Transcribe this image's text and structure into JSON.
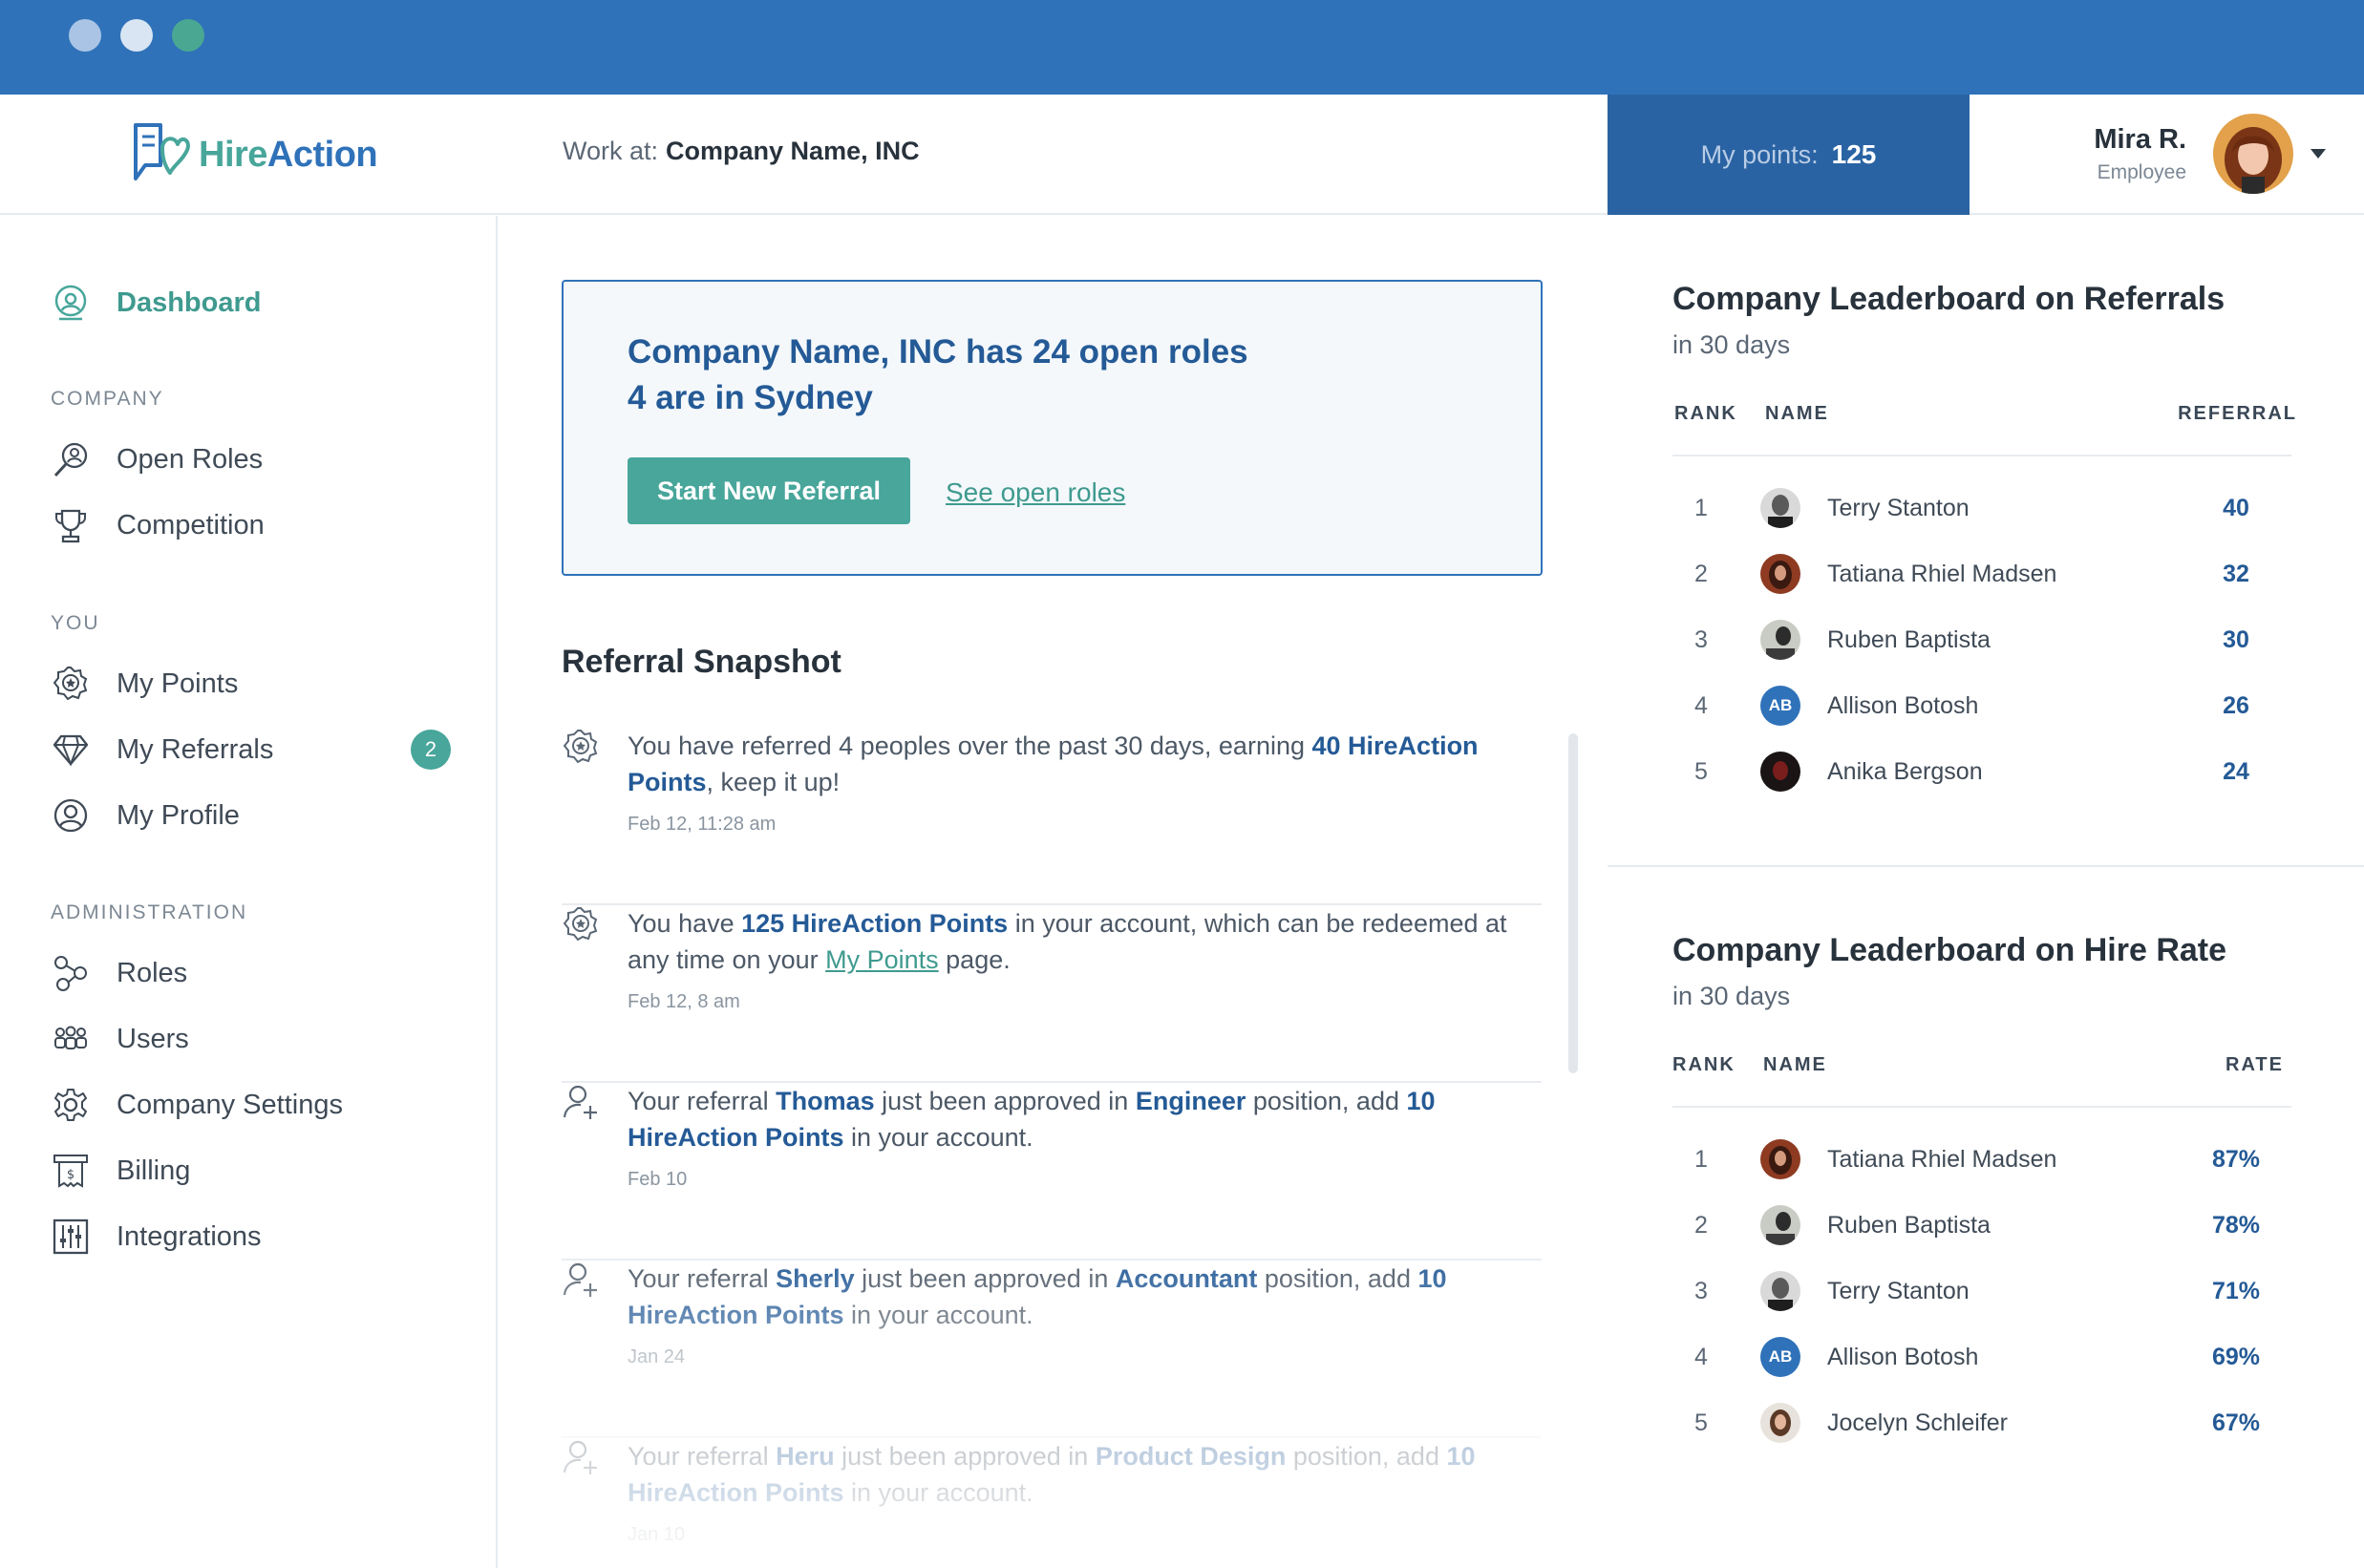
{
  "colors": {
    "chrome": "#2f72b9",
    "brand_teal": "#48a69b",
    "brand_blue": "#245a96",
    "points_bg": "#2a63a3"
  },
  "header": {
    "logo_hire": "Hire",
    "logo_action": "Action",
    "work_at_label": "Work at:",
    "company": "Company Name, INC",
    "points_label": "My points:",
    "points_value": "125",
    "user_name": "Mira R.",
    "user_role": "Employee"
  },
  "sidebar": {
    "dashboard": "Dashboard",
    "section_company": "COMPANY",
    "open_roles": "Open Roles",
    "competition": "Competition",
    "section_you": "YOU",
    "my_points": "My Points",
    "my_referrals": "My Referrals",
    "my_referrals_badge": "2",
    "my_profile": "My Profile",
    "section_admin": "ADMINISTRATION",
    "roles": "Roles",
    "users": "Users",
    "company_settings": "Company Settings",
    "billing": "Billing",
    "integrations": "Integrations"
  },
  "banner": {
    "line1": "Company Name, INC has 24 open roles",
    "line2": "4 are in Sydney",
    "cta": "Start New Referral",
    "link": "See open roles"
  },
  "snapshot": {
    "title": "Referral Snapshot",
    "items": [
      {
        "icon": "badge-icon",
        "t1": "You have referred 4 peoples over the past 30 days, earning ",
        "b1": "40 HireAction Points",
        "t2": ", keep it up!",
        "date": "Feb 12, 11:28 am"
      },
      {
        "icon": "badge-icon",
        "t1": "You have ",
        "b1": "125 HireAction Points",
        "t2": " in your account, which can be redeemed at any time on your ",
        "link": "My Points",
        "t3": " page.",
        "date": "Feb 12, 8 am"
      },
      {
        "icon": "user-plus-icon",
        "t1": "Your referral ",
        "b1": "Thomas",
        "t2": " just been approved in ",
        "b2": "Engineer",
        "t3": " position, add ",
        "b3": "10 HireAction Points",
        "t4": " in your account.",
        "date": "Feb 10"
      },
      {
        "icon": "user-plus-icon",
        "t1": "Your referral ",
        "b1": "Sherly",
        "t2": " just been approved in ",
        "b2": "Accountant",
        "t3": " position, add ",
        "b3": "10 HireAction Points",
        "t4": " in your account.",
        "date": "Jan 24"
      },
      {
        "icon": "user-plus-icon",
        "t1": "Your referral ",
        "b1": "Heru",
        "t2": " just been approved in ",
        "b2": "Product Design",
        "t3": " position, add ",
        "b3": "10 HireAction Points",
        "t4": " in your account.",
        "date": "Jan 10"
      }
    ]
  },
  "leaderboard_referrals": {
    "title": "Company Leaderboard on Referrals",
    "subtitle": "in 30 days",
    "col_rank": "RANK",
    "col_name": "NAME",
    "col_value": "REFERRAL",
    "rows": [
      {
        "rank": "1",
        "name": "Terry Stanton",
        "value": "40"
      },
      {
        "rank": "2",
        "name": "Tatiana Rhiel Madsen",
        "value": "32"
      },
      {
        "rank": "3",
        "name": "Ruben Baptista",
        "value": "30"
      },
      {
        "rank": "4",
        "name": "Allison Botosh",
        "value": "26",
        "initials": "AB"
      },
      {
        "rank": "5",
        "name": "Anika Bergson",
        "value": "24"
      }
    ]
  },
  "leaderboard_hire": {
    "title": "Company Leaderboard on Hire Rate",
    "subtitle": "in 30 days",
    "col_rank": "RANK",
    "col_name": "NAME",
    "col_value": "RATE",
    "rows": [
      {
        "rank": "1",
        "name": "Tatiana Rhiel Madsen",
        "value": "87%"
      },
      {
        "rank": "2",
        "name": "Ruben Baptista",
        "value": "78%"
      },
      {
        "rank": "3",
        "name": "Terry Stanton",
        "value": "71%"
      },
      {
        "rank": "4",
        "name": "Allison Botosh",
        "value": "69%",
        "initials": "AB"
      },
      {
        "rank": "5",
        "name": "Jocelyn Schleifer",
        "value": "67%"
      }
    ]
  }
}
